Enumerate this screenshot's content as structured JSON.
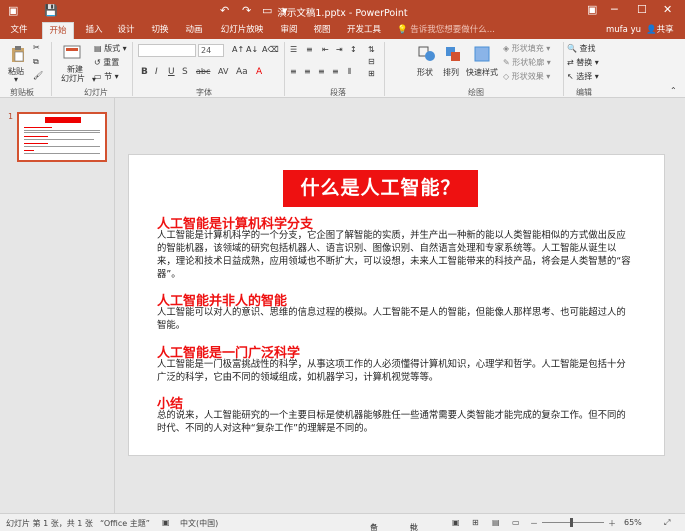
{
  "titlebar": {
    "title": "演示文稿1.pptx - PowerPoint",
    "save_icon": "save-icon",
    "undo_icon": "undo-icon",
    "redo_icon": "redo-icon",
    "present_icon": "present-icon"
  },
  "tabs": [
    "文件",
    "开始",
    "插入",
    "设计",
    "切换",
    "动画",
    "幻灯片放映",
    "审阅",
    "视图",
    "开发工具"
  ],
  "tellme": "告诉我您想要做什么...",
  "user": "mufa yu",
  "share": "共享",
  "ribbon": {
    "clipboard": {
      "paste": "粘贴",
      "label": "剪贴板"
    },
    "slides": {
      "new_slide": "新建",
      "new_slide2": "幻灯片",
      "layout": "版式",
      "reset": "重置",
      "section": "节",
      "label": "幻灯片"
    },
    "font": {
      "font_name": "",
      "font_size": "24",
      "label": "字体"
    },
    "paragraph": {
      "label": "段落"
    },
    "drawing": {
      "shape": "形状",
      "arrange": "排列",
      "quick_styles": "快速样式",
      "fill": "形状填充",
      "outline": "形状轮廓",
      "effects": "形状效果",
      "label": "绘图"
    },
    "editing": {
      "find": "查找",
      "replace": "替换",
      "select": "选择",
      "label": "编辑"
    }
  },
  "slide": {
    "title": "什么是人工智能？",
    "sections": [
      {
        "heading": "人工智能是计算机科学分支",
        "body": "人工智能是计算机科学的一个分支，它企图了解智能的实质，并生产出一种新的能以人类智能相似的方式做出反应的智能机器，该领域的研究包括机器人、语言识别、图像识别、自然语言处理和专家系统等。人工智能从诞生以来，理论和技术日益成熟，应用领域也不断扩大，可以设想，未来人工智能带来的科技产品，将会是人类智慧的“容器”。"
      },
      {
        "heading": "人工智能并非人的智能",
        "body": "人工智能可以对人的意识、思维的信息过程的模拟。人工智能不是人的智能，但能像人那样思考、也可能超过人的智能。"
      },
      {
        "heading": "人工智能是一门广泛科学",
        "body": "人工智能是一门极富挑战性的科学，从事这项工作的人必须懂得计算机知识，心理学和哲学。人工智能是包括十分广泛的科学，它由不同的领域组成，如机器学习，计算机视觉等等。"
      },
      {
        "heading": "小结",
        "body": "总的说来，人工智能研究的一个主要目标是使机器能够胜任一些通常需要人类智能才能完成的复杂工作。但不同的时代、不同的人对这种“复杂工作”的理解是不同的。"
      }
    ]
  },
  "thumbnail": {
    "number": "1"
  },
  "status": {
    "slide_info": "幻灯片 第 1 张，共 1 张",
    "theme": "“Office 主题”",
    "language": "中文(中国)",
    "notes": "备注",
    "comments": "批注",
    "zoom": "65%"
  },
  "colors": {
    "accent": "#b7472a",
    "title_red": "#ee1111"
  }
}
